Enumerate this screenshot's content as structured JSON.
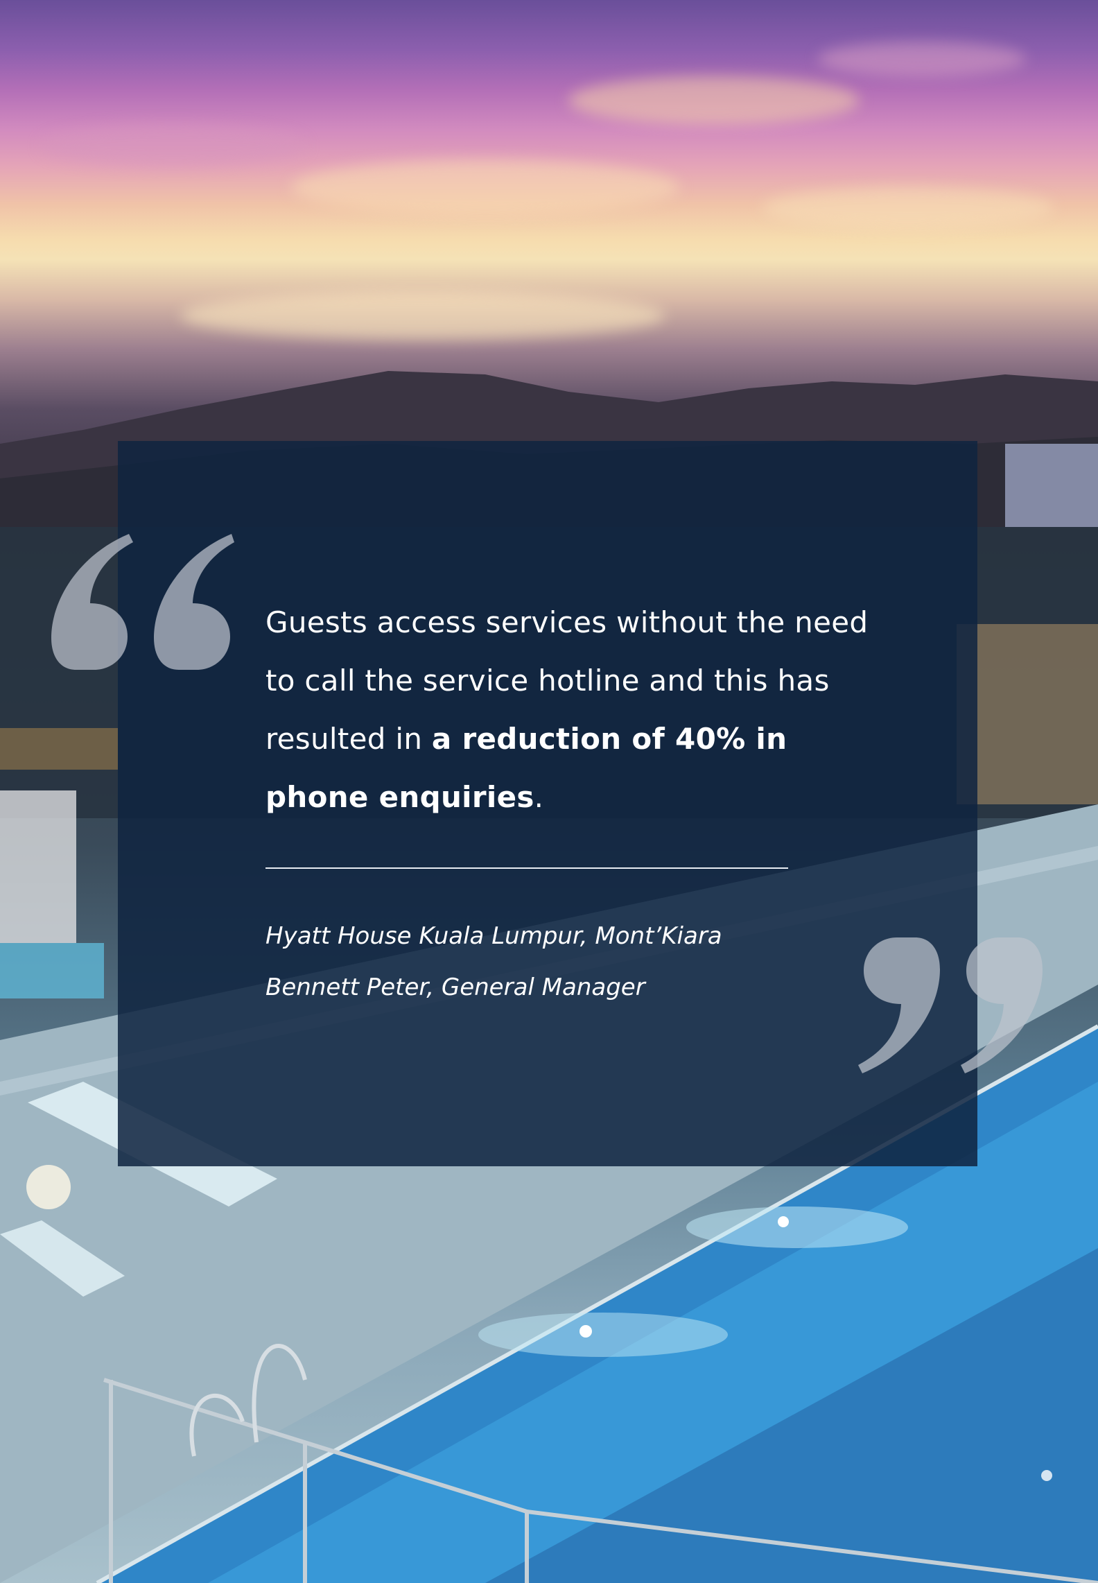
{
  "background": {
    "scene": "rooftop-pool-at-sunset-photo"
  },
  "quote": {
    "open_mark_icon": "open-quote-icon",
    "close_mark_icon": "close-quote-icon",
    "text_plain_1": "Guests access services without the need to call the service hotline and this has resulted in ",
    "text_bold": "a reduction of 40% in phone enquiries",
    "text_plain_2": ".",
    "attribution_org": "Hyatt House Kuala Lumpur, Mont’Kiara",
    "attribution_person": "Bennett Peter, General Manager"
  },
  "colors": {
    "panel": "#0f2440",
    "text": "#ffffff",
    "quote_marks": "#bec3cd"
  }
}
